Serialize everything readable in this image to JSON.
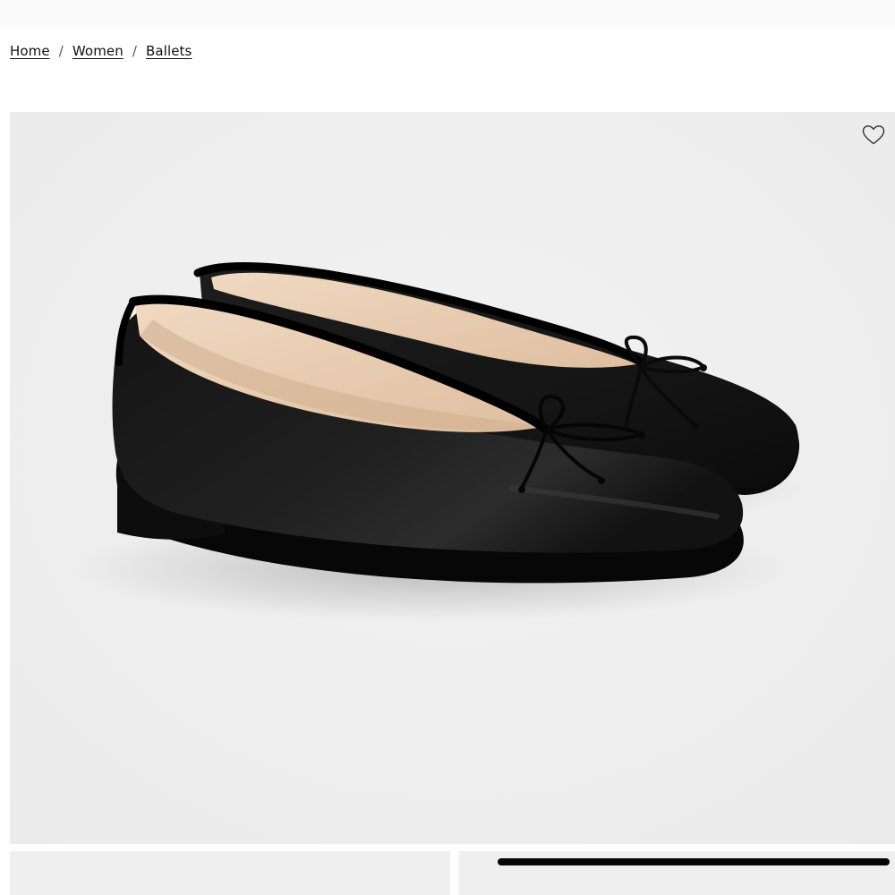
{
  "breadcrumb": {
    "items": [
      {
        "label": "Home"
      },
      {
        "label": "Women"
      },
      {
        "label": "Ballets"
      }
    ],
    "separator": "/"
  },
  "product": {
    "image_subject": "black leather ballet flats with bow",
    "wishlist_icon": "heart-outline-icon"
  },
  "colors": {
    "image_background": "#efefef",
    "shoe": "#121212",
    "lining": "#e9cdb2",
    "scroll_thumb": "#050505"
  }
}
